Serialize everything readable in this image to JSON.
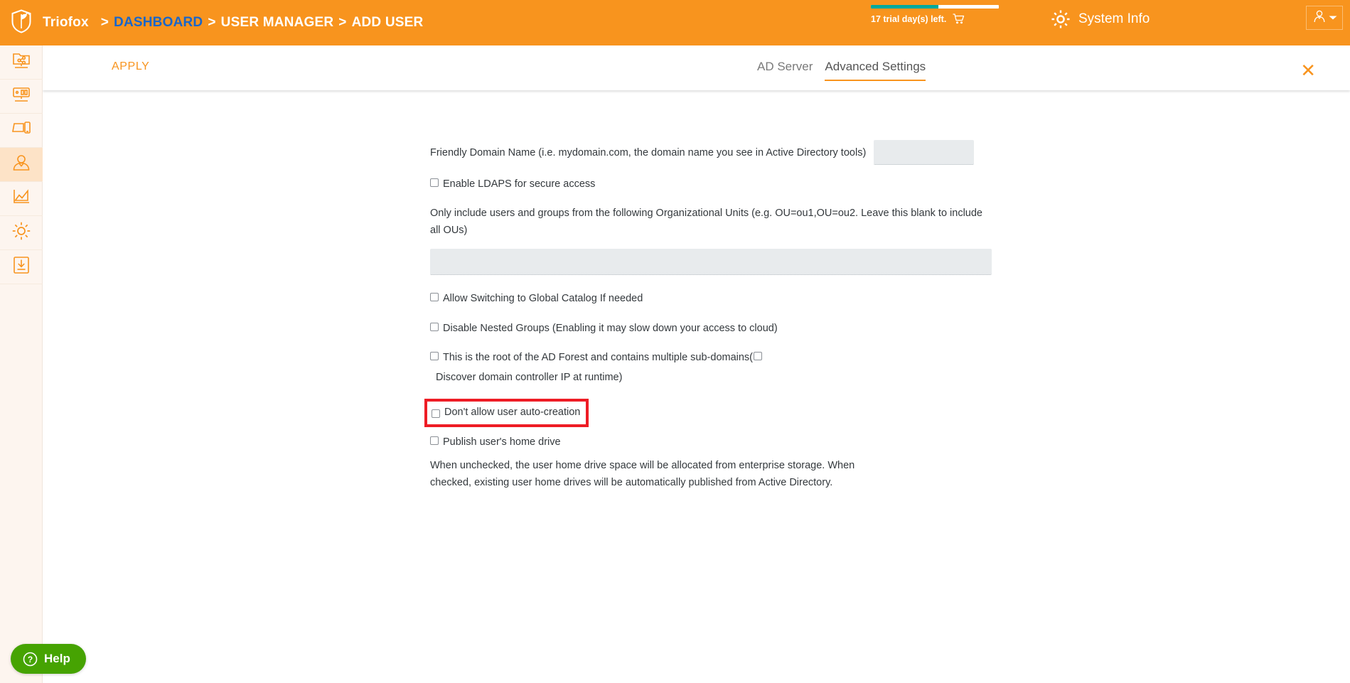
{
  "header": {
    "brand": "Triofox",
    "logo_icon": "shield-logo-icon",
    "breadcrumbs": [
      {
        "label": "DASHBOARD",
        "active": true
      },
      {
        "label": "USER MANAGER",
        "active": false
      },
      {
        "label": "ADD USER",
        "active": false
      }
    ],
    "separator": ">",
    "trial": {
      "text": "17 trial day(s) left.",
      "cart_icon": "shopping-cart-icon",
      "progress_percent": 53,
      "bar_fill_color": "#00a99d",
      "bar_track_color": "#ffffff"
    },
    "system_info": {
      "label": "System Info",
      "icon": "gear-icon"
    },
    "user_menu": {
      "avatar_icon": "user-avatar-icon",
      "caret_icon": "chevron-down-icon"
    },
    "background_color": "#f8941e"
  },
  "sidebar": {
    "background_color": "#fdf5ef",
    "items": [
      {
        "name": "shared-folder",
        "icon": "share-folder-icon",
        "active": false
      },
      {
        "name": "server",
        "icon": "server-monitor-icon",
        "active": false
      },
      {
        "name": "devices",
        "icon": "devices-icon",
        "active": false
      },
      {
        "name": "users",
        "icon": "user-icon",
        "active": true
      },
      {
        "name": "reports",
        "icon": "chart-line-icon",
        "active": false
      },
      {
        "name": "settings",
        "icon": "gear-icon",
        "active": false
      },
      {
        "name": "downloads",
        "icon": "download-box-icon",
        "active": false
      }
    ]
  },
  "toolbar": {
    "apply_label": "APPLY",
    "close_icon": "close-icon",
    "tabs": [
      {
        "label": "AD Server",
        "active": false
      },
      {
        "label": "Advanced Settings",
        "active": true
      }
    ],
    "accent_color": "#f8941e"
  },
  "form": {
    "friendly_domain": {
      "label": "Friendly Domain Name (i.e. mydomain.com, the domain name you see in Active Directory tools)",
      "value": "",
      "placeholder": ""
    },
    "enable_ldaps": {
      "label": "Enable LDAPS for secure access",
      "checked": false
    },
    "ou_helper": "Only include users and groups from the following Organizational Units (e.g. OU=ou1,OU=ou2. Leave this blank to include all OUs)",
    "ou_input": {
      "value": "",
      "placeholder": ""
    },
    "allow_global_catalog": {
      "label": "Allow Switching to Global Catalog If needed",
      "checked": false
    },
    "disable_nested_groups": {
      "label": "Disable Nested Groups (Enabling it may slow down your access to cloud)",
      "checked": false
    },
    "ad_forest_root": {
      "label": "This is the root of the AD Forest and contains multiple sub-domains(",
      "checked": false,
      "sub_label": "Discover domain controller IP at runtime)",
      "sub_checked": false
    },
    "no_auto_creation": {
      "label": "Don't allow user auto-creation",
      "checked": false,
      "highlighted": true,
      "highlight_color": "#ee1c25"
    },
    "publish_home_drive": {
      "label": "Publish user's home drive",
      "checked": false
    },
    "home_drive_description": "When unchecked, the user home drive space will be allocated from enterprise storage. When checked, existing user home drives will be automatically published from Active Directory."
  },
  "help": {
    "label": "Help",
    "icon": "question-circle-icon",
    "color": "#46a302"
  }
}
